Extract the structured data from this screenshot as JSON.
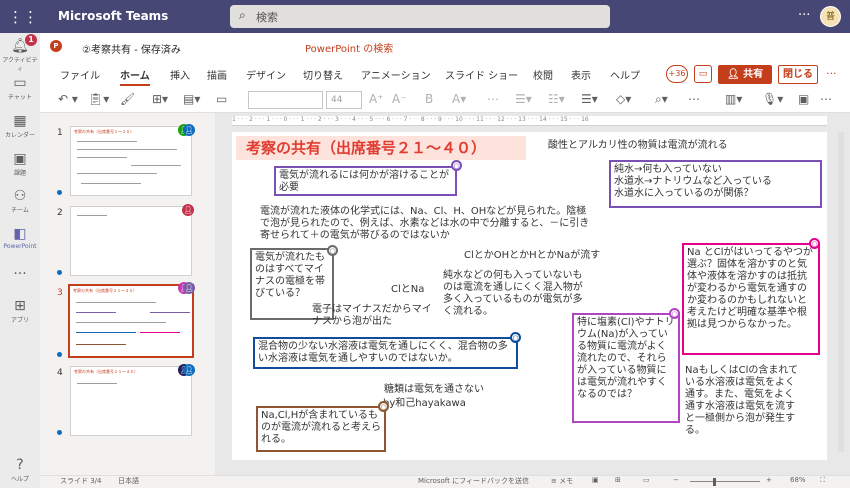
{
  "topbar": {
    "app_title": "Microsoft Teams",
    "search_placeholder": "検索",
    "more": "···",
    "avatar": "普"
  },
  "rail": {
    "badge": "1",
    "items": [
      {
        "label": "アクティビティ",
        "icon": "bell-icon"
      },
      {
        "label": "チャット",
        "icon": "chat-icon"
      },
      {
        "label": "カレンダー",
        "icon": "calendar-icon"
      },
      {
        "label": "課題",
        "icon": "assignments-icon"
      },
      {
        "label": "チーム",
        "icon": "teams-icon"
      },
      {
        "label": "PowerPoint",
        "icon": "powerpoint-icon"
      },
      {
        "label": "···",
        "icon": "more-icon"
      },
      {
        "label": "アプリ",
        "icon": "apps-icon"
      },
      {
        "label": "ヘルプ",
        "icon": "help-icon"
      }
    ]
  },
  "doc": {
    "title": "②考察共有 - 保存済み",
    "ppt_search": "PowerPoint の検索"
  },
  "menu": [
    "ファイル",
    "ホーム",
    "挿入",
    "描画",
    "デザイン",
    "切り替え",
    "アニメーション",
    "スライド ショー",
    "校閲",
    "表示",
    "ヘルプ"
  ],
  "actions": {
    "comments_count": "+36",
    "share": "共有",
    "close": "閉じる"
  },
  "toolbar": {
    "font_size": "44"
  },
  "thumbs": {
    "numbers": [
      "1",
      "2",
      "3",
      "4"
    ],
    "titles": [
      "考察の共有（出席番号１～２０）",
      "",
      "考察の共有（出席番号２１～４０）",
      "考察の共有（出席番号２１～４０）"
    ]
  },
  "ruler": "1 · · · 2 · · · 1 · · · 0 · · · 1 · · · 2 · · · 3 · · · 4 · · · 5 · · · 6 · · · 7 · · · 8 · · · 9 · · · 10 · · · 11 · · · 12 · · · 13 · · · 14 · · · 15 · · · 16",
  "slide": {
    "title": "考察の共有（出席番号２１～４０）",
    "subtitle": "酸性とアルカリ性の物質は電流が流れる",
    "b_purple1": "電気が流れるには何かが溶けることが必要",
    "b_purple2_l1": "純水→何も入っていない",
    "b_purple2_l2": "水道水→ナトリウムなど入っている",
    "b_purple2_l3": "水道水に入っているのが関係？",
    "t_ions": "電流が流れた液体の化学式には、Na、Cl、H、OHなどが見られた。陰極で泡が見られたので、例えば、水素などは水の中で分離すると、－に引き寄せられて＋の電気が帯びるのではないか",
    "t_clh": "ClとかOHとかHとかNaが流す",
    "b_pink1": "Na とClがはいってるやつが選ぶ？固体を溶かすのと気体や液体を溶かすのは抵抗が変わるから電気を通すのか変わるのかもしれないと考えたけど明確な基準や根拠は見つからなかった。",
    "b_gray": "電気が流れたものはすべてマイナスの電極を帯びている？",
    "t_clna": "ClとNa",
    "t_pure": "純水などの何も入っていないものは電流を通しにくく混入物が多く入っているものが電気が多く流れる。",
    "t_electron": "電子はマイナスだからマイナスから泡が出た",
    "b_blue": "混合物の少ない水溶液は電気を通しにくく、混合物の多い水溶液は電気を通しやすいのではないか。",
    "b_magenta": "特に塩素(Cl)やナトリウム(Na)が入っている物質に電流がよく流れたので、それらが入っている物質には電気が流れやすくなるのでは？",
    "t_nacl": "NaもしくはClの含まれている水溶液は電気をよく通す。また、電気をよく通す水溶液は電気を流すと一極側から泡が発生する。",
    "t_sugar": "糖類は電気を通さない",
    "t_name": "by和己hayakawa",
    "b_brown": "Na,Cl,Hが含まれているものが電流が流れると考えられる。"
  },
  "status": {
    "slide": "スライド 3/4",
    "lang": "日本語",
    "feedback": "Microsoft にフィードバックを送信",
    "notes": "メモ",
    "zoom": "68%"
  }
}
